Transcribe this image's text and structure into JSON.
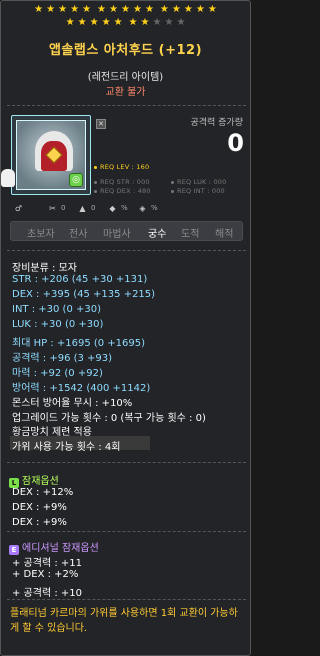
{
  "stars": {
    "row1": [
      1,
      1,
      1,
      1,
      1,
      1,
      1,
      1,
      1,
      1,
      1,
      1,
      1,
      1,
      1
    ],
    "row2": [
      1,
      1,
      1,
      1,
      1,
      1,
      1,
      0,
      0,
      0
    ]
  },
  "item": {
    "name": "앱솔랩스 아처후드 (+12)",
    "grade": "(레전드리 아이템)",
    "trade": "교환 불가"
  },
  "attack_change": {
    "label": "공격력 증가량",
    "value": "0"
  },
  "requirements": {
    "lev": "REQ LEV : 160",
    "str": "REQ STR : 000",
    "luk": "REQ LUK : 000",
    "dex": "REQ DEX : 480",
    "int": "REQ INT : 000"
  },
  "mini_icons": [
    {
      "name": "gender-icon",
      "glyph": "♂",
      "value": ""
    },
    {
      "name": "scissors-icon",
      "glyph": "✂",
      "value": "0"
    },
    {
      "name": "upgrade-icon",
      "glyph": "▲",
      "value": "0"
    },
    {
      "name": "shield-icon",
      "glyph": "◆",
      "value": "%"
    },
    {
      "name": "potential-icon",
      "glyph": "◈",
      "value": "%"
    }
  ],
  "jobs": [
    "초보자",
    "전사",
    "마법사",
    "궁수",
    "도적",
    "해적"
  ],
  "active_job": "궁수",
  "stats": [
    {
      "text": "장비분류 : 모자",
      "color": "white"
    },
    {
      "text": "STR : +206 (45 +30 +131)",
      "color": "blue"
    },
    {
      "text": "DEX : +395 (45 +135 +215)",
      "color": "blue"
    },
    {
      "text": "INT : +30 (0 +30)",
      "color": "blue"
    },
    {
      "text": "LUK : +30 (0 +30)",
      "color": "blue"
    },
    {
      "text": "최대 HP : +1695 (0 +1695)",
      "color": "blue"
    },
    {
      "text": "공격력 : +96 (3 +93)",
      "color": "blue"
    },
    {
      "text": "마력 : +92 (0 +92)",
      "color": "blue"
    },
    {
      "text": "방어력 : +1542 (400 +1142)",
      "color": "blue"
    },
    {
      "text": "몬스터 방어율 무시 : +10%",
      "color": "white"
    },
    {
      "text": "업그레이드 가능 횟수 : 0 (복구 가능 횟수 : 0)",
      "color": "white"
    },
    {
      "text": "황금망치 제련 적용",
      "color": "white"
    },
    {
      "text": "가위 사용 가능 횟수 : 4회",
      "color": "white"
    }
  ],
  "potential": {
    "title": "잠재옵션",
    "lines": [
      "DEX : +12%",
      "DEX : +9%",
      "DEX : +9%"
    ]
  },
  "additional": {
    "title": "에디셔널 잠재옵션",
    "lines": [
      "+ 공격력 : +11",
      "+ DEX : +2%",
      "+ 공격력 : +10"
    ]
  },
  "footer": "플래티넘 카르마의 가위를 사용하면 1회 교환이 가능하게 할 수 있습니다."
}
